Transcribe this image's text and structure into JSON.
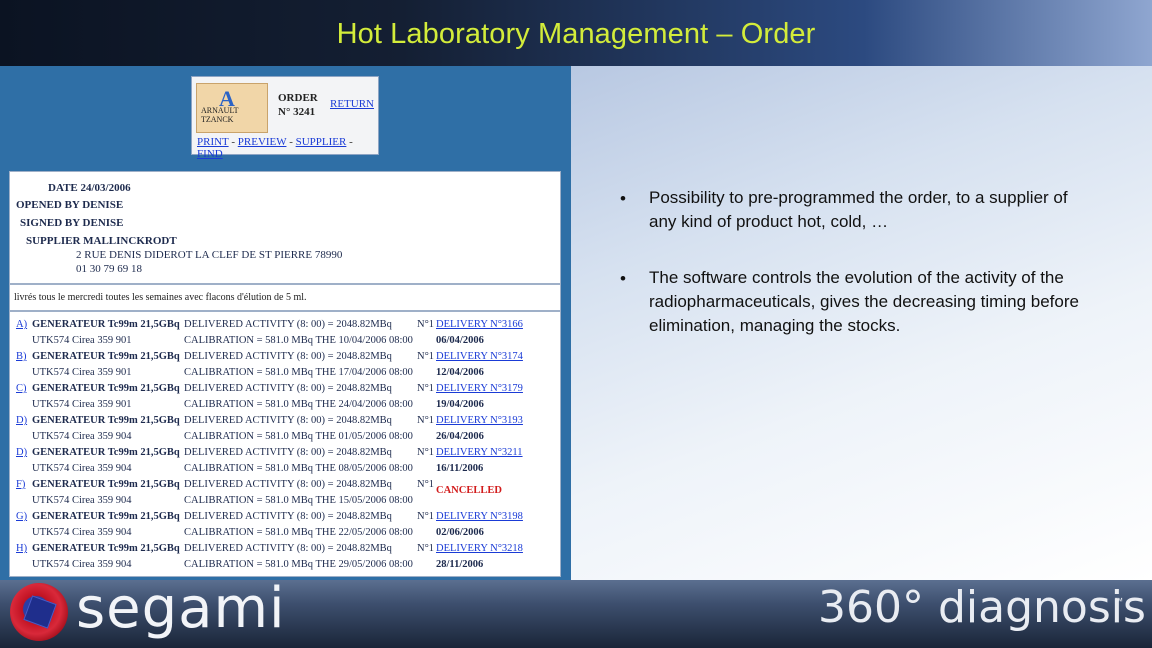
{
  "title": "Hot Laboratory Management – Order",
  "order_header": {
    "logo_text_1": "ARNAULT",
    "logo_text_2": "TZANCK",
    "order_label": "ORDER",
    "order_number": "N° 3241",
    "return_link": "RETURN",
    "links": [
      "PRINT",
      "PREVIEW",
      "SUPPLIER",
      "FIND"
    ],
    "separator": " - "
  },
  "info": {
    "date": "DATE 24/03/2006",
    "opened_by": "OPENED BY DENISE",
    "signed_by": "SIGNED BY DENISE",
    "supplier": "SUPPLIER MALLINCKRODT",
    "address": "2 RUE DENIS DIDEROT LA CLEF DE ST PIERRE 78990",
    "phone": "01 30 79 69 18"
  },
  "note": "livrés tous le mercredi toutes les semaines avec flacons d'élution de 5 ml.",
  "deliveries": [
    {
      "letter": "A)",
      "product": "GENERATEUR Tc99m 21,5GBq",
      "activity": "DELIVERED ACTIVITY (8: 00) = 2048.82MBq",
      "num": "N°1",
      "delivery": "DELIVERY N°3166",
      "utk": "UTK574 Cirea 359 901",
      "calibration": "CALIBRATION = 581.0 MBq THE 10/04/2006 08:00",
      "date": "06/04/2006"
    },
    {
      "letter": "B)",
      "product": "GENERATEUR Tc99m 21,5GBq",
      "activity": "DELIVERED ACTIVITY (8: 00) = 2048.82MBq",
      "num": "N°1",
      "delivery": "DELIVERY N°3174",
      "utk": "UTK574 Cirea 359 901",
      "calibration": "CALIBRATION = 581.0 MBq THE 17/04/2006 08:00",
      "date": "12/04/2006"
    },
    {
      "letter": "C)",
      "product": "GENERATEUR Tc99m 21,5GBq",
      "activity": "DELIVERED ACTIVITY (8: 00) = 2048.82MBq",
      "num": "N°1",
      "delivery": "DELIVERY N°3179",
      "utk": "UTK574 Cirea 359 901",
      "calibration": "CALIBRATION = 581.0 MBq THE 24/04/2006 08:00",
      "date": "19/04/2006"
    },
    {
      "letter": "D)",
      "product": "GENERATEUR Tc99m 21,5GBq",
      "activity": "DELIVERED ACTIVITY (8: 00) = 2048.82MBq",
      "num": "N°1",
      "delivery": "DELIVERY N°3193",
      "utk": "UTK574 Cirea 359 904",
      "calibration": "CALIBRATION = 581.0 MBq THE 01/05/2006 08:00",
      "date": "26/04/2006"
    },
    {
      "letter": "D)",
      "product": "GENERATEUR Tc99m 21,5GBq",
      "activity": "DELIVERED ACTIVITY (8: 00) = 2048.82MBq",
      "num": "N°1",
      "delivery": "DELIVERY N°3211",
      "utk": "UTK574 Cirea 359 904",
      "calibration": "CALIBRATION = 581.0 MBq THE 08/05/2006 08:00",
      "date": "16/11/2006"
    },
    {
      "letter": "F)",
      "product": "GENERATEUR Tc99m 21,5GBq",
      "activity": "DELIVERED ACTIVITY (8: 00) = 2048.82MBq",
      "num": "N°1",
      "delivery": "",
      "cancelled": "CANCELLED",
      "utk": "UTK574 Cirea 359 904",
      "calibration": "CALIBRATION = 581.0 MBq THE 15/05/2006 08:00",
      "date": ""
    },
    {
      "letter": "G)",
      "product": "GENERATEUR Tc99m 21,5GBq",
      "activity": "DELIVERED ACTIVITY (8: 00) = 2048.82MBq",
      "num": "N°1",
      "delivery": "DELIVERY N°3198",
      "utk": "UTK574 Cirea 359 904",
      "calibration": "CALIBRATION = 581.0 MBq THE 22/05/2006 08:00",
      "date": "02/06/2006"
    },
    {
      "letter": "H)",
      "product": "GENERATEUR Tc99m 21,5GBq",
      "activity": "DELIVERED ACTIVITY (8: 00) = 2048.82MBq",
      "num": "N°1",
      "delivery": "DELIVERY N°3218",
      "utk": "UTK574 Cirea 359 904",
      "calibration": "CALIBRATION = 581.0 MBq THE 29/05/2006 08:00",
      "date": "28/11/2006"
    }
  ],
  "bullets": [
    {
      "marker": "•",
      "text": "Possibility to pre-programmed the order, to a supplier of any kind of product hot, cold, …"
    },
    {
      "marker": "•",
      "text": "The software controls the evolution of the activity of the  radiopharmaceuticals, gives the decreasing timing before elimination, managing the stocks."
    }
  ],
  "footer": {
    "left_brand": "segami",
    "right_brand": "360° diagnosis",
    "trademark": "™"
  }
}
